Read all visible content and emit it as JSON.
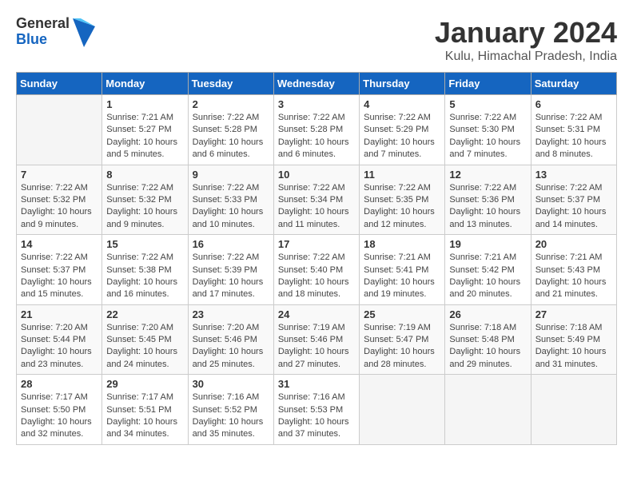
{
  "header": {
    "logo_general": "General",
    "logo_blue": "Blue",
    "month": "January 2024",
    "location": "Kulu, Himachal Pradesh, India"
  },
  "weekdays": [
    "Sunday",
    "Monday",
    "Tuesday",
    "Wednesday",
    "Thursday",
    "Friday",
    "Saturday"
  ],
  "weeks": [
    [
      {
        "day": "",
        "info": ""
      },
      {
        "day": "1",
        "info": "Sunrise: 7:21 AM\nSunset: 5:27 PM\nDaylight: 10 hours\nand 5 minutes."
      },
      {
        "day": "2",
        "info": "Sunrise: 7:22 AM\nSunset: 5:28 PM\nDaylight: 10 hours\nand 6 minutes."
      },
      {
        "day": "3",
        "info": "Sunrise: 7:22 AM\nSunset: 5:28 PM\nDaylight: 10 hours\nand 6 minutes."
      },
      {
        "day": "4",
        "info": "Sunrise: 7:22 AM\nSunset: 5:29 PM\nDaylight: 10 hours\nand 7 minutes."
      },
      {
        "day": "5",
        "info": "Sunrise: 7:22 AM\nSunset: 5:30 PM\nDaylight: 10 hours\nand 7 minutes."
      },
      {
        "day": "6",
        "info": "Sunrise: 7:22 AM\nSunset: 5:31 PM\nDaylight: 10 hours\nand 8 minutes."
      }
    ],
    [
      {
        "day": "7",
        "info": "Sunrise: 7:22 AM\nSunset: 5:32 PM\nDaylight: 10 hours\nand 9 minutes."
      },
      {
        "day": "8",
        "info": "Sunrise: 7:22 AM\nSunset: 5:32 PM\nDaylight: 10 hours\nand 9 minutes."
      },
      {
        "day": "9",
        "info": "Sunrise: 7:22 AM\nSunset: 5:33 PM\nDaylight: 10 hours\nand 10 minutes."
      },
      {
        "day": "10",
        "info": "Sunrise: 7:22 AM\nSunset: 5:34 PM\nDaylight: 10 hours\nand 11 minutes."
      },
      {
        "day": "11",
        "info": "Sunrise: 7:22 AM\nSunset: 5:35 PM\nDaylight: 10 hours\nand 12 minutes."
      },
      {
        "day": "12",
        "info": "Sunrise: 7:22 AM\nSunset: 5:36 PM\nDaylight: 10 hours\nand 13 minutes."
      },
      {
        "day": "13",
        "info": "Sunrise: 7:22 AM\nSunset: 5:37 PM\nDaylight: 10 hours\nand 14 minutes."
      }
    ],
    [
      {
        "day": "14",
        "info": "Sunrise: 7:22 AM\nSunset: 5:37 PM\nDaylight: 10 hours\nand 15 minutes."
      },
      {
        "day": "15",
        "info": "Sunrise: 7:22 AM\nSunset: 5:38 PM\nDaylight: 10 hours\nand 16 minutes."
      },
      {
        "day": "16",
        "info": "Sunrise: 7:22 AM\nSunset: 5:39 PM\nDaylight: 10 hours\nand 17 minutes."
      },
      {
        "day": "17",
        "info": "Sunrise: 7:22 AM\nSunset: 5:40 PM\nDaylight: 10 hours\nand 18 minutes."
      },
      {
        "day": "18",
        "info": "Sunrise: 7:21 AM\nSunset: 5:41 PM\nDaylight: 10 hours\nand 19 minutes."
      },
      {
        "day": "19",
        "info": "Sunrise: 7:21 AM\nSunset: 5:42 PM\nDaylight: 10 hours\nand 20 minutes."
      },
      {
        "day": "20",
        "info": "Sunrise: 7:21 AM\nSunset: 5:43 PM\nDaylight: 10 hours\nand 21 minutes."
      }
    ],
    [
      {
        "day": "21",
        "info": "Sunrise: 7:20 AM\nSunset: 5:44 PM\nDaylight: 10 hours\nand 23 minutes."
      },
      {
        "day": "22",
        "info": "Sunrise: 7:20 AM\nSunset: 5:45 PM\nDaylight: 10 hours\nand 24 minutes."
      },
      {
        "day": "23",
        "info": "Sunrise: 7:20 AM\nSunset: 5:46 PM\nDaylight: 10 hours\nand 25 minutes."
      },
      {
        "day": "24",
        "info": "Sunrise: 7:19 AM\nSunset: 5:46 PM\nDaylight: 10 hours\nand 27 minutes."
      },
      {
        "day": "25",
        "info": "Sunrise: 7:19 AM\nSunset: 5:47 PM\nDaylight: 10 hours\nand 28 minutes."
      },
      {
        "day": "26",
        "info": "Sunrise: 7:18 AM\nSunset: 5:48 PM\nDaylight: 10 hours\nand 29 minutes."
      },
      {
        "day": "27",
        "info": "Sunrise: 7:18 AM\nSunset: 5:49 PM\nDaylight: 10 hours\nand 31 minutes."
      }
    ],
    [
      {
        "day": "28",
        "info": "Sunrise: 7:17 AM\nSunset: 5:50 PM\nDaylight: 10 hours\nand 32 minutes."
      },
      {
        "day": "29",
        "info": "Sunrise: 7:17 AM\nSunset: 5:51 PM\nDaylight: 10 hours\nand 34 minutes."
      },
      {
        "day": "30",
        "info": "Sunrise: 7:16 AM\nSunset: 5:52 PM\nDaylight: 10 hours\nand 35 minutes."
      },
      {
        "day": "31",
        "info": "Sunrise: 7:16 AM\nSunset: 5:53 PM\nDaylight: 10 hours\nand 37 minutes."
      },
      {
        "day": "",
        "info": ""
      },
      {
        "day": "",
        "info": ""
      },
      {
        "day": "",
        "info": ""
      }
    ]
  ]
}
